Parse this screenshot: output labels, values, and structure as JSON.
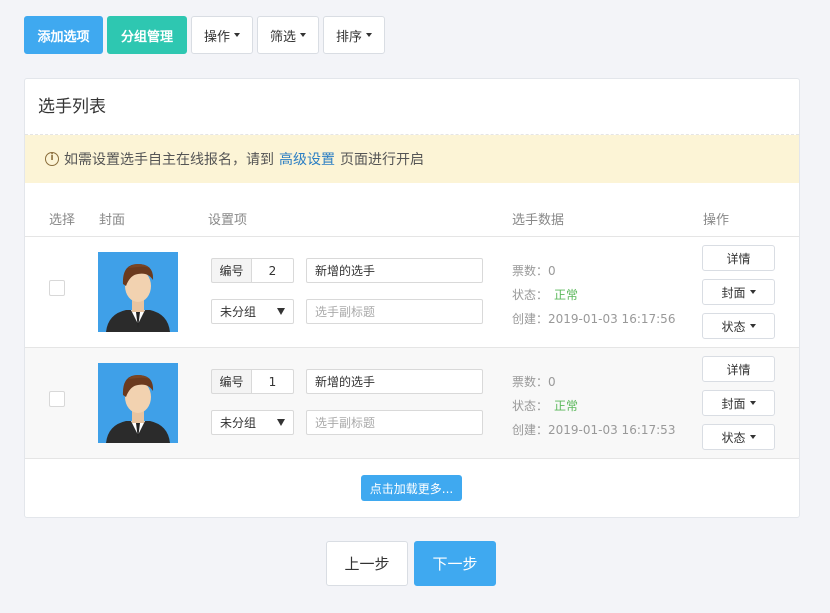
{
  "toolbar": {
    "add_label": "添加选项",
    "group_label": "分组管理",
    "operate_label": "操作",
    "filter_label": "筛选",
    "sort_label": "排序"
  },
  "panel": {
    "title": "选手列表",
    "notice": {
      "prefix": "如需设置选手自主在线报名，请到",
      "link": "高级设置",
      "suffix": "页面进行开启"
    }
  },
  "table": {
    "headers": {
      "select": "选择",
      "cover": "封面",
      "settings": "设置项",
      "data": "选手数据",
      "ops": "操作"
    },
    "rows": [
      {
        "num_label": "编号",
        "num": "2",
        "name": "新增的选手",
        "group": "未分组",
        "subtitle_placeholder": "选手副标题",
        "votes": "票数：0",
        "status_label": "状态：",
        "status": "正常",
        "created": "创建：2019-01-03 16:17:56",
        "detail": "详情",
        "cover": "封面",
        "state": "状态"
      },
      {
        "num_label": "编号",
        "num": "1",
        "name": "新增的选手",
        "group": "未分组",
        "subtitle_placeholder": "选手副标题",
        "votes": "票数：0",
        "status_label": "状态：",
        "status": "正常",
        "created": "创建：2019-01-03 16:17:53",
        "detail": "详情",
        "cover": "封面",
        "state": "状态"
      }
    ],
    "load_more": "点击加载更多..."
  },
  "pager": {
    "prev": "上一步",
    "next": "下一步"
  },
  "colors": {
    "primary": "#3fa9f0",
    "teal": "#2ec7b1",
    "notice_bg": "#fcf4d6",
    "link": "#2b7ec3",
    "ok": "#5cb85c"
  }
}
